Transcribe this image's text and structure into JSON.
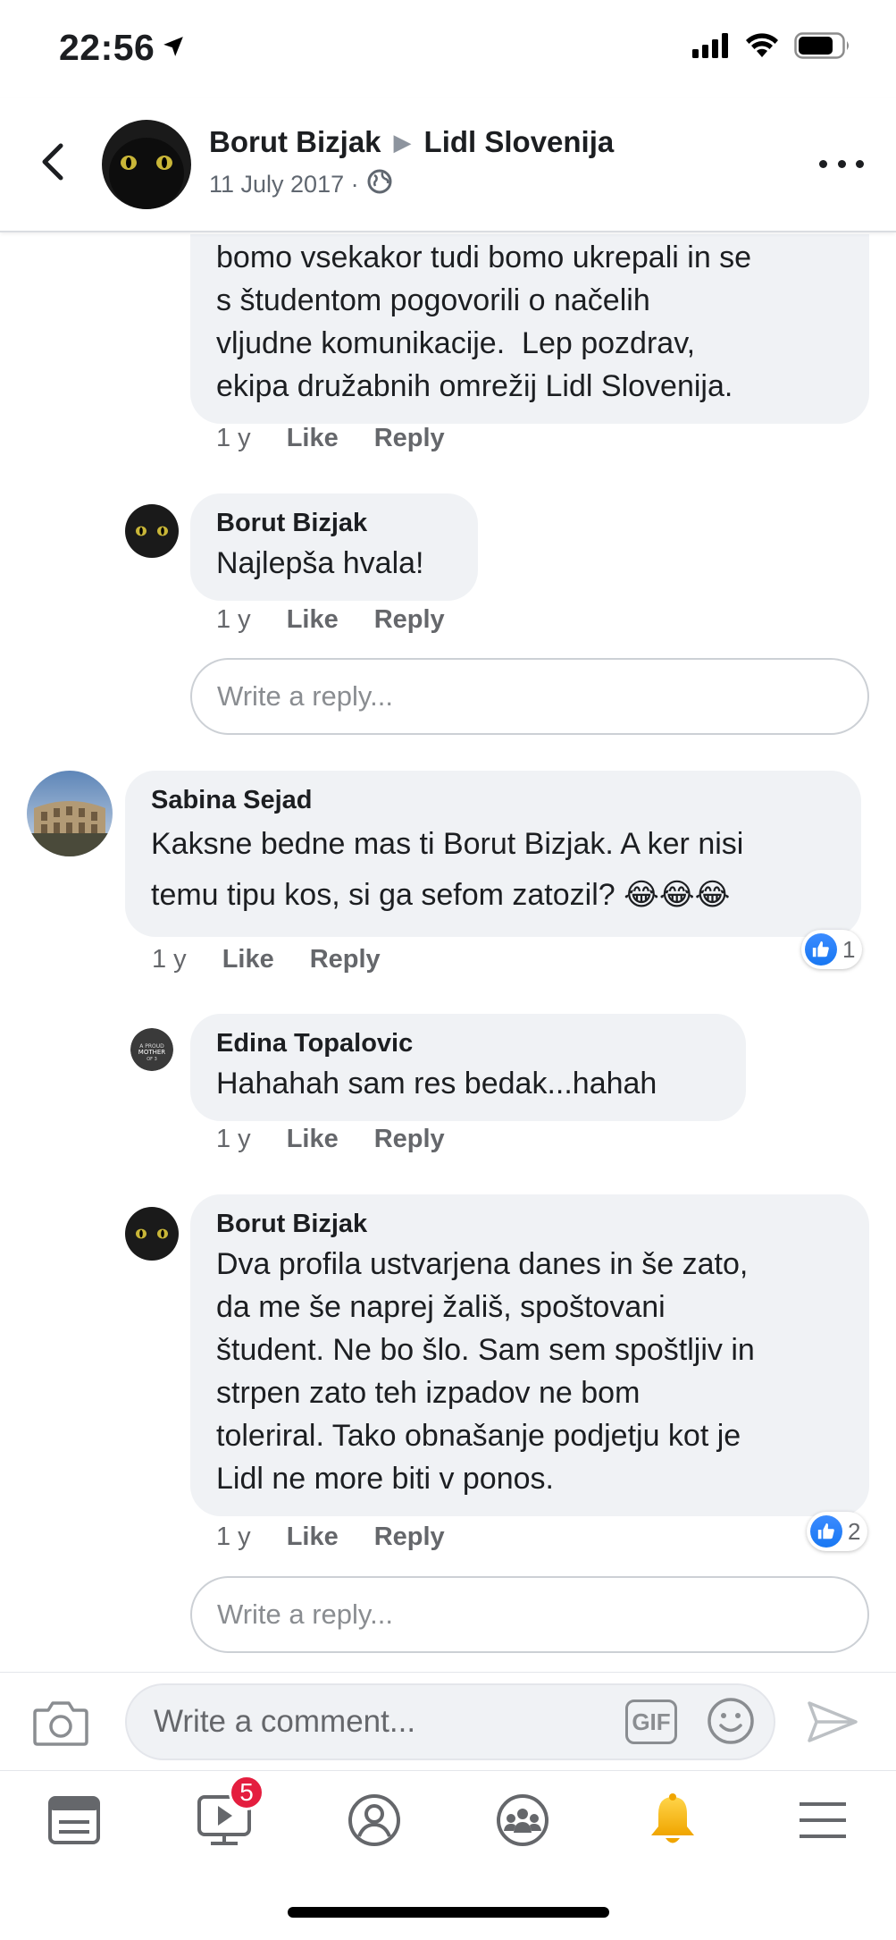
{
  "status_bar": {
    "time": "22:56"
  },
  "header": {
    "author": "Borut Bizjak",
    "target_page": "Lidl Slovenija",
    "date": "11 July 2017 ·"
  },
  "comments": [
    {
      "text": "bomo vsekakor tudi bomo ukrepali in se\ns študentom pogovorili o načelih\nvljudne komunikacije.  Lep pozdrav,\nekipa družabnih omrežij Lidl Slovenija.",
      "time": "1 y",
      "like": "Like",
      "reply": "Reply"
    },
    {
      "author": "Borut Bizjak",
      "text": "Najlepša hvala!",
      "time": "1 y",
      "like": "Like",
      "reply": "Reply"
    },
    {
      "author": "Sabina Sejad",
      "text": "Kaksne bedne mas ti Borut Bizjak. A ker nisi\ntemu tipu kos, si ga sefom zatozil? 😂😂😂",
      "time": "1 y",
      "like": "Like",
      "reply": "Reply",
      "reaction_count": "1"
    },
    {
      "author": "Edina Topalovic",
      "text": "Hahahah sam res bedak...hahah",
      "time": "1 y",
      "like": "Like",
      "reply": "Reply"
    },
    {
      "author": "Borut Bizjak",
      "text": "Dva profila ustvarjena danes in še zato,\nda me še naprej žališ, spoštovani\nštudent. Ne bo šlo. Sam sem spoštljiv in\nstrpen zato teh izpadov ne bom\ntoleriral. Tako obnašanje podjetju kot je\nLidl ne more biti v ponos.",
      "time": "1 y",
      "like": "Like",
      "reply": "Reply",
      "reaction_count": "2"
    }
  ],
  "reply_placeholder": "Write a reply...",
  "composer": {
    "placeholder": "Write a comment...",
    "gif_label": "GIF"
  },
  "tabbar": {
    "video_badge": "5"
  },
  "icons": [
    "location-arrow-icon",
    "signal-icon",
    "wifi-icon",
    "battery-icon",
    "back-chevron-icon",
    "globe-icon",
    "more-icon",
    "like-icon",
    "camera-icon",
    "emoji-icon",
    "send-icon",
    "news-feed-icon",
    "watch-icon",
    "profile-icon",
    "groups-icon",
    "notifications-icon",
    "menu-icon"
  ],
  "colors": {
    "accent": "#1877f2",
    "bubble": "#f0f2f5",
    "muted": "#65676b",
    "badge": "#e41e3f",
    "bell": "#f7b928"
  }
}
